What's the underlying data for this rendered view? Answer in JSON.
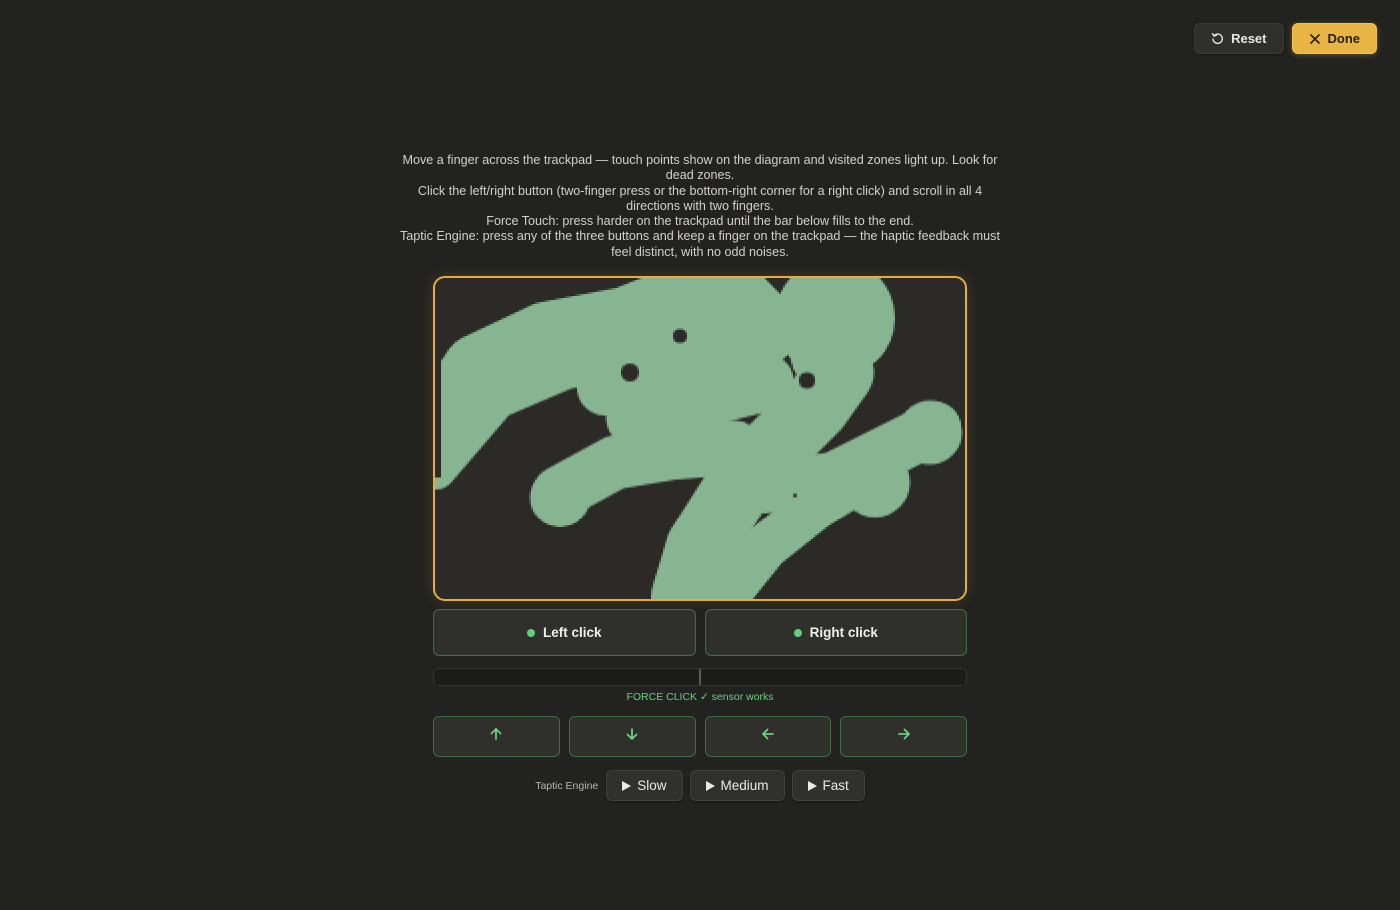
{
  "actions": {
    "reset_label": "Reset",
    "done_label": "Done"
  },
  "instructions": [
    "Move a finger across the trackpad — touch points show on the diagram and visited zones light up. Look for dead zones.",
    "Click the left/right button (two-finger press or the bottom-right corner for a right click) and scroll in all 4 directions with two fingers.",
    "Force Touch: press harder on the trackpad until the bar below fills to the end.",
    "Taptic Engine: press any of the three buttons and keep a finger on the trackpad — the haptic feedback must feel distinct, with no odd noises."
  ],
  "clicks": {
    "left_label": "Left click",
    "right_label": "Right click"
  },
  "force": {
    "level": 0,
    "status": "FORCE CLICK ✓ sensor works"
  },
  "scroll": {
    "up_icon": "arrow-up-icon",
    "down_icon": "arrow-down-icon",
    "left_icon": "arrow-left-icon",
    "right_icon": "arrow-right-icon"
  },
  "taptic": {
    "label": "Taptic Engine",
    "slow_label": "Slow",
    "medium_label": "Medium",
    "fast_label": "Fast"
  },
  "colors": {
    "accent": "#e8b545",
    "visited_zone": "#88b591",
    "trackpad_bg": "#2b2a27",
    "ok": "#5fcf7a"
  }
}
